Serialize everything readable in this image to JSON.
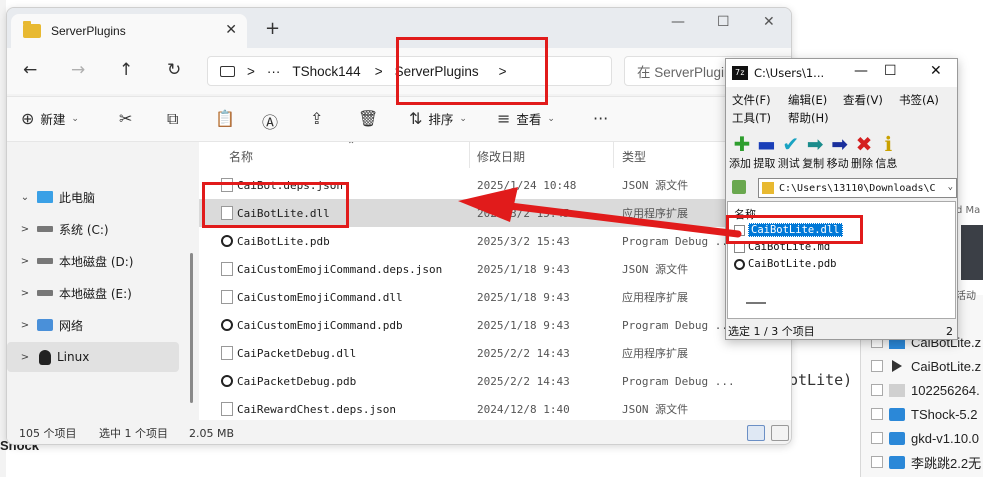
{
  "background": {
    "bottom_text": "Shock",
    "right_label_m": "d Ma",
    "right_huodong": "活动",
    "right_paren": "otLite)",
    "right_items": [
      {
        "label": "CaiBotLite.z",
        "icon": "zip-icon"
      },
      {
        "label": "CaiBotLite.z",
        "icon": "play-icon"
      },
      {
        "label": "102256264.",
        "icon": "page-icon"
      },
      {
        "label": "TShock-5.2",
        "icon": "folder-icon"
      },
      {
        "label": "gkd-v1.10.0",
        "icon": "folder-icon"
      },
      {
        "label": "李跳跳2.2无",
        "icon": "folder-icon"
      }
    ]
  },
  "explorer": {
    "tab_title": "ServerPlugins",
    "tab_close": "✕",
    "tab_new": "+",
    "controls": {
      "minimize": "—",
      "maximize": "☐",
      "close": "✕"
    },
    "nav": {
      "back": "←",
      "forward": "→",
      "up": "↑",
      "refresh": "↻"
    },
    "breadcrumb": {
      "sep1": ">",
      "ellipsis": "···",
      "crumb1": "TShock144",
      "sep2": ">",
      "crumb2": "ServerPlugins",
      "sep3": ">"
    },
    "search_placeholder": "在 ServerPlugins",
    "toolbar": {
      "new": "新建",
      "sort": "排序",
      "view": "查看",
      "more": "···"
    },
    "sidebar": [
      {
        "label": "此电脑",
        "arrow": "⌄",
        "icon": "pc-icon",
        "selected": false
      },
      {
        "label": "系统 (C:)",
        "arrow": ">",
        "icon": "drive-icon",
        "selected": false
      },
      {
        "label": "本地磁盘 (D:)",
        "arrow": ">",
        "icon": "drive-icon",
        "selected": false
      },
      {
        "label": "本地磁盘 (E:)",
        "arrow": ">",
        "icon": "drive-icon",
        "selected": false
      },
      {
        "label": "网络",
        "arrow": ">",
        "icon": "network-icon",
        "selected": false
      },
      {
        "label": "Linux",
        "arrow": ">",
        "icon": "linux-icon",
        "selected": true
      }
    ],
    "columns": {
      "name": "名称",
      "date": "修改日期",
      "type": "类型"
    },
    "files": [
      {
        "name": "CaiBot.deps.json",
        "date": "2025/1/24 10:48",
        "type": "JSON 源文件",
        "kind": "json",
        "selected": false
      },
      {
        "name": "CaiBotLite.dll",
        "date": "2025/3/2 15:45",
        "type": "应用程序扩展",
        "kind": "dll",
        "selected": true
      },
      {
        "name": "CaiBotLite.pdb",
        "date": "2025/3/2 15:43",
        "type": "Program Debug ...",
        "kind": "pdb",
        "selected": false
      },
      {
        "name": "CaiCustomEmojiCommand.deps.json",
        "date": "2025/1/18 9:43",
        "type": "JSON 源文件",
        "kind": "json",
        "selected": false
      },
      {
        "name": "CaiCustomEmojiCommand.dll",
        "date": "2025/1/18 9:43",
        "type": "应用程序扩展",
        "kind": "dll",
        "selected": false
      },
      {
        "name": "CaiCustomEmojiCommand.pdb",
        "date": "2025/1/18 9:43",
        "type": "Program Debug ...",
        "kind": "pdb",
        "selected": false
      },
      {
        "name": "CaiPacketDebug.dll",
        "date": "2025/2/2 14:43",
        "type": "应用程序扩展",
        "kind": "dll",
        "selected": false
      },
      {
        "name": "CaiPacketDebug.pdb",
        "date": "2025/2/2 14:43",
        "type": "Program Debug ...",
        "kind": "pdb",
        "selected": false
      },
      {
        "name": "CaiRewardChest.deps.json",
        "date": "2024/12/8 1:40",
        "type": "JSON 源文件",
        "kind": "json",
        "selected": false
      }
    ],
    "status": {
      "count": "105 个项目",
      "selected": "选中 1 个项目",
      "size": "2.05 MB"
    }
  },
  "sevenzip": {
    "logo": "7z",
    "title": "C:\\Users\\1...",
    "controls": {
      "minimize": "—",
      "maximize": "☐",
      "close": "✕"
    },
    "menu": [
      "文件(F)",
      "编辑(E)",
      "查看(V)",
      "书签(A)",
      "工具(T)",
      "帮助(H)"
    ],
    "tools": [
      {
        "label": "添加",
        "glyph": "✚",
        "color": "#2e9e2e",
        "name": "add"
      },
      {
        "label": "提取",
        "glyph": "▬",
        "color": "#1a3fb8",
        "name": "extract"
      },
      {
        "label": "测试",
        "glyph": "✔",
        "color": "#19a3c2",
        "name": "test"
      },
      {
        "label": "复制",
        "glyph": "➡",
        "color": "#1a8c8c",
        "name": "copy"
      },
      {
        "label": "移动",
        "glyph": "➡",
        "color": "#1a2f9c",
        "name": "move"
      },
      {
        "label": "删除",
        "glyph": "✖",
        "color": "#d41f1f",
        "name": "delete"
      },
      {
        "label": "信息",
        "glyph": "ℹ",
        "color": "#c9a100",
        "name": "info"
      }
    ],
    "path": "C:\\Users\\13110\\Downloads\\C",
    "list_header": "名称",
    "items": [
      {
        "name": "CaiBotLite.dll",
        "kind": "dll",
        "selected": true
      },
      {
        "name": "CaiBotLite.md",
        "kind": "md",
        "selected": false
      },
      {
        "name": "CaiBotLite.pdb",
        "kind": "pdb",
        "selected": false
      }
    ],
    "status": "选定 1 / 3 个项目",
    "status_right": "2"
  },
  "colors": {
    "annotation": "#e11b1b",
    "selection": "#0078d7"
  }
}
